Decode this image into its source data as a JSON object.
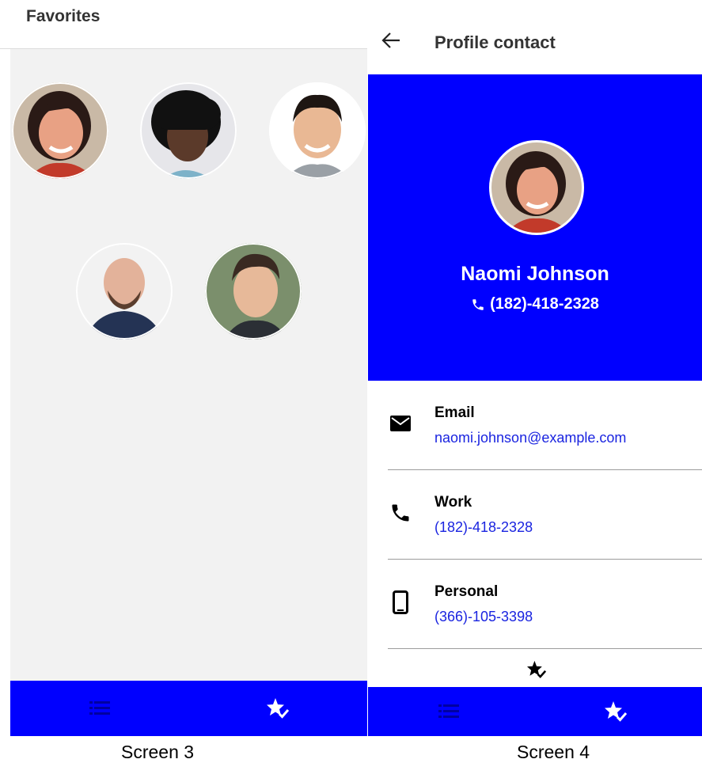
{
  "screen3": {
    "title": "Favorites",
    "caption": "Screen 3",
    "favorites": [
      {
        "icon": "avatar-woman-1"
      },
      {
        "icon": "avatar-woman-2"
      },
      {
        "icon": "avatar-man-1"
      },
      {
        "icon": "avatar-man-bald"
      },
      {
        "icon": "avatar-man-2"
      }
    ],
    "nav": [
      {
        "icon": "list-icon"
      },
      {
        "icon": "star-check-icon"
      }
    ]
  },
  "screen4": {
    "title": "Profile contact",
    "caption": "Screen 4",
    "profile": {
      "name": "Naomi Johnson",
      "phone": "(182)-418-2328"
    },
    "details": [
      {
        "label": "Email",
        "value": "naomi.johnson@example.com",
        "icon": "mail-icon"
      },
      {
        "label": "Work",
        "value": "(182)-418-2328",
        "icon": "phone-icon"
      },
      {
        "label": "Personal",
        "value": "(366)-105-3398",
        "icon": "mobile-phone-icon"
      }
    ],
    "nav": [
      {
        "icon": "list-icon"
      },
      {
        "icon": "star-check-icon"
      }
    ]
  },
  "colors": {
    "primary": "#0000ff",
    "link": "#1a24e0",
    "background": "#f2f2f2"
  }
}
